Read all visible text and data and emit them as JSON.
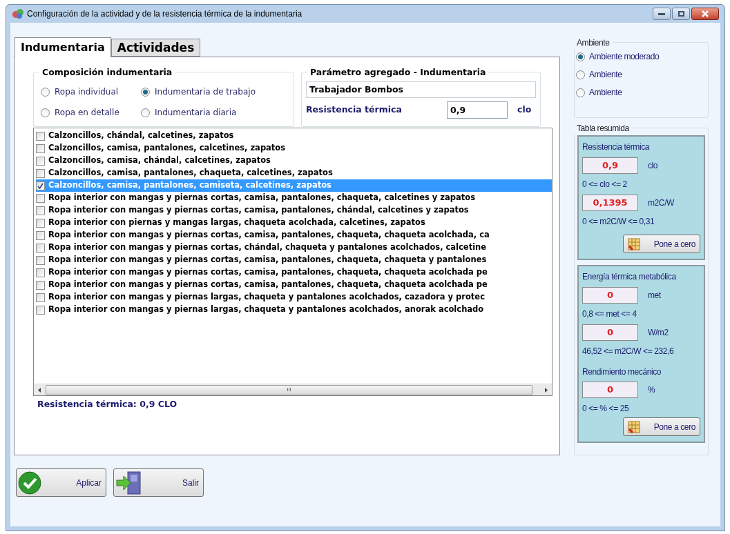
{
  "window": {
    "title": "Configuración de la actividad y de la resistencia térmica de la indumentaria"
  },
  "tabs": [
    {
      "label": "Indumentaria",
      "selected": true
    },
    {
      "label": "Actividades",
      "selected": false
    }
  ],
  "composition": {
    "title": "Composición indumentaria",
    "options": [
      {
        "label": "Ropa individual",
        "selected": false
      },
      {
        "label": "Indumentaria de trabajo",
        "selected": true
      },
      {
        "label": "Ropa en detalle",
        "selected": false
      },
      {
        "label": "Indumentaria diaria",
        "selected": false
      }
    ]
  },
  "aggregate": {
    "title": "Parámetro agregado - Indumentaria",
    "name": "Trabajador Bombos",
    "resistance_label": "Resistencia térmica",
    "resistance_value": "0,9",
    "unit": "clo"
  },
  "garments": [
    {
      "label": "Calzoncillos, chándal, calcetines, zapatos",
      "checked": false,
      "selected": false
    },
    {
      "label": "Calzoncillos, camisa, pantalones, calcetines, zapatos",
      "checked": false,
      "selected": false
    },
    {
      "label": "Calzoncillos, camisa, chándal, calcetines, zapatos",
      "checked": false,
      "selected": false
    },
    {
      "label": "Calzoncillos, camisa, pantalones, chaqueta, calcetines, zapatos",
      "checked": false,
      "selected": false
    },
    {
      "label": "Calzoncillos, camisa, pantalones, camiseta, calcetines, zapatos",
      "checked": true,
      "selected": true
    },
    {
      "label": "Ropa interior con mangas y piernas cortas, camisa, pantalones, chaqueta, calcetines y zapatos",
      "checked": false,
      "selected": false
    },
    {
      "label": "Ropa interior con mangas y piernas cortas, camisa, pantalones, chándal, calcetines y zapatos",
      "checked": false,
      "selected": false
    },
    {
      "label": "Ropa interior con piernas y mangas largas, chaqueta acolchada, calcetines, zapatos",
      "checked": false,
      "selected": false
    },
    {
      "label": "Ropa interior con mangas y piernas cortas, camisa, pantalones, chaqueta, chaqueta acolchada, ca",
      "checked": false,
      "selected": false
    },
    {
      "label": "Ropa interior con mangas y piernas cortas, chándal, chaqueta y pantalones acolchados, calcetine",
      "checked": false,
      "selected": false
    },
    {
      "label": "Ropa interior con mangas y piernas cortas, camisa, pantalones, chaqueta, chaqueta y pantalones",
      "checked": false,
      "selected": false
    },
    {
      "label": "Ropa interior con mangas y piernas cortas, camisa, pantalones, chaqueta, chaqueta acolchada pe",
      "checked": false,
      "selected": false
    },
    {
      "label": "Ropa interior con mangas y piernas cortas, camisa, pantalones, chaqueta, chaqueta acolchada pe",
      "checked": false,
      "selected": false
    },
    {
      "label": "Ropa interior con mangas y piernas largas, chaqueta y pantalones acolchados, cazadora y protec",
      "checked": false,
      "selected": false
    },
    {
      "label": "Ropa interior con mangas y piernas largas, chaqueta y pantalones acolchados, anorak acolchado",
      "checked": false,
      "selected": false
    }
  ],
  "scrollbar_grip": "III",
  "summary_label": "Resistencia térmica: 0,9 CLO",
  "buttons": [
    {
      "label": "Aplicar",
      "kind": "apply"
    },
    {
      "label": "Salir",
      "kind": "exit"
    }
  ],
  "ambiente": {
    "title": "Ambiente",
    "options": [
      {
        "label": "Ambiente moderado",
        "selected": true
      },
      {
        "label": "Ambiente",
        "selected": false
      },
      {
        "label": "Ambiente",
        "selected": false
      }
    ]
  },
  "tabla": {
    "title": "Tabla resumida",
    "panels": [
      {
        "title": "Resistencia térmica",
        "items": [
          {
            "kind": "value",
            "value": "0,9",
            "unit": "clo"
          },
          {
            "kind": "range",
            "text": "0 <= clo <= 2"
          },
          {
            "kind": "value",
            "value": "0,1395",
            "unit": "m2C/W"
          },
          {
            "kind": "range",
            "text": "0 <= m2C/W <= 0,31"
          }
        ],
        "button": "Pone a cero"
      },
      {
        "title": "Energía térmica metabólica",
        "items": [
          {
            "kind": "value",
            "value": "0",
            "unit": "met"
          },
          {
            "kind": "range",
            "text": "0,8 <= met <= 4"
          },
          {
            "kind": "value",
            "value": "0",
            "unit": "W/m2"
          },
          {
            "kind": "range",
            "text": "46,52 <= m2C/W <= 232,6"
          },
          {
            "kind": "heading",
            "text": "Rendimiento mecánico"
          },
          {
            "kind": "value",
            "value": "0",
            "unit": "%"
          },
          {
            "kind": "range",
            "text": "0 <= % <= 25"
          }
        ],
        "button": "Pone a cero"
      }
    ]
  }
}
